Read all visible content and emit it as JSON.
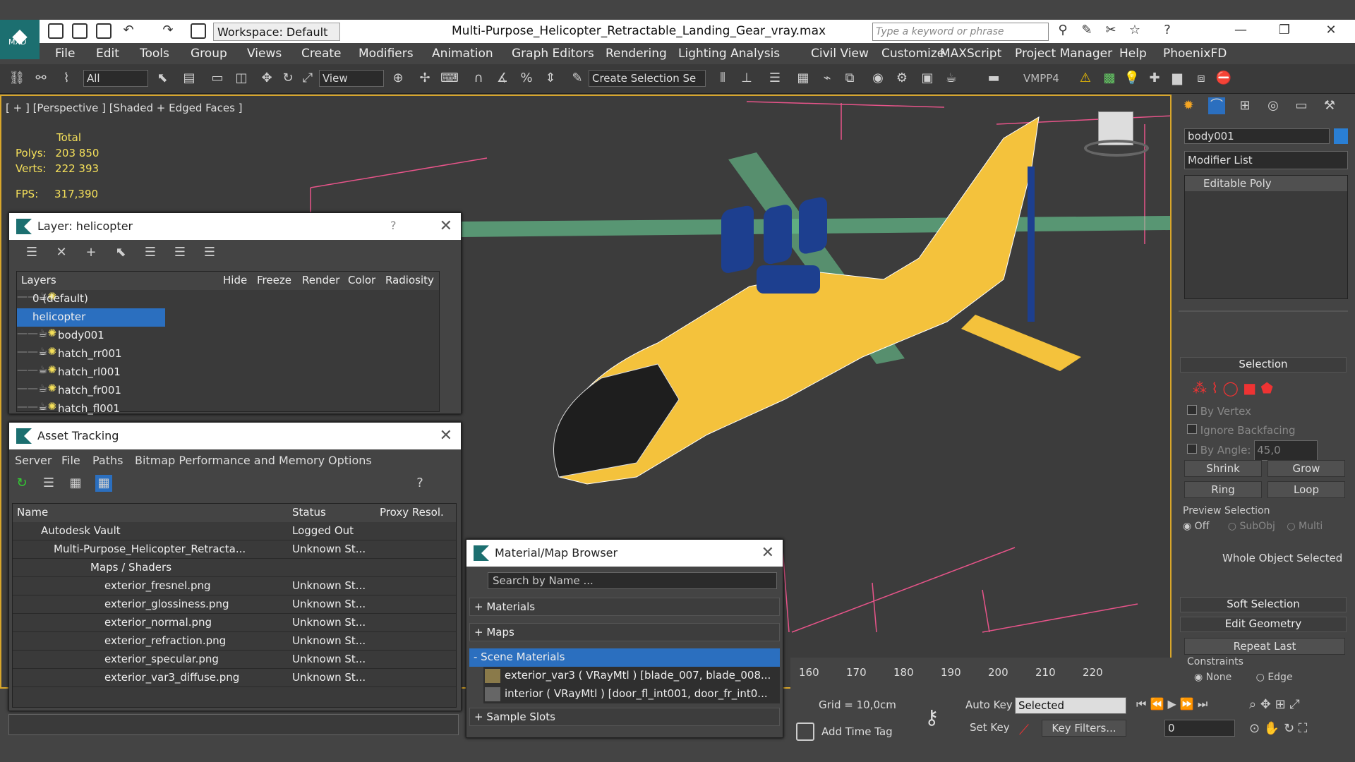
{
  "app": {
    "window_title": "Multi-Purpose_Helicopter_Retractable_Landing_Gear_vray.max",
    "logo_text": "MXD",
    "workspace": "Workspace: Default",
    "search_placeholder": "Type a keyword or phrase"
  },
  "menu": [
    "File",
    "Edit",
    "Tools",
    "Group",
    "Views",
    "Create",
    "Modifiers",
    "Animation",
    "Graph Editors",
    "Rendering",
    "Lighting Analysis",
    "Civil View",
    "Customize",
    "MAXScript",
    "Project Manager",
    "Help",
    "PhoenixFD"
  ],
  "toolbar": {
    "filter": "All",
    "ref_coord": "View",
    "selection_set": "Create Selection Se",
    "vmpp": "VMPP4"
  },
  "viewport": {
    "label": "[ + ] [Perspective ] [Shaded + Edged Faces ]",
    "stats_total": "Total",
    "polys_label": "Polys:",
    "polys_value": "203 850",
    "verts_label": "Verts:",
    "verts_value": "222 393",
    "fps_label": "FPS:",
    "fps_value": "317,390"
  },
  "layer_window": {
    "title": "Layer: helicopter",
    "help": "?",
    "columns": [
      "Layers",
      "Hide",
      "Freeze",
      "Render",
      "Color",
      "Radiosity"
    ],
    "rows": [
      {
        "name": "0 (default)",
        "color": "#b5e04a"
      },
      {
        "name": "helicopter",
        "color": "#a8e0e0"
      },
      {
        "name": "body001",
        "color": "#1e5fc0"
      },
      {
        "name": "hatch_rr001",
        "color": "#1e5fc0"
      },
      {
        "name": "hatch_rl001",
        "color": "#1e5fc0"
      },
      {
        "name": "hatch_fr001",
        "color": "#1e5fc0"
      },
      {
        "name": "hatch_fl001",
        "color": "#1e5fc0"
      }
    ]
  },
  "asset_window": {
    "title": "Asset Tracking",
    "menu": [
      "Server",
      "File",
      "Paths",
      "Bitmap Performance and Memory",
      "Options"
    ],
    "columns": [
      "Name",
      "Status",
      "Proxy Resol."
    ],
    "rows": [
      {
        "name": "Autodesk Vault",
        "status": "Logged Out"
      },
      {
        "name": "Multi-Purpose_Helicopter_Retracta...",
        "status": "Unknown St..."
      },
      {
        "name": "Maps / Shaders",
        "status": ""
      },
      {
        "name": "exterior_fresnel.png",
        "status": "Unknown St..."
      },
      {
        "name": "exterior_glossiness.png",
        "status": "Unknown St..."
      },
      {
        "name": "exterior_normal.png",
        "status": "Unknown St..."
      },
      {
        "name": "exterior_refraction.png",
        "status": "Unknown St..."
      },
      {
        "name": "exterior_specular.png",
        "status": "Unknown St..."
      },
      {
        "name": "exterior_var3_diffuse.png",
        "status": "Unknown St..."
      }
    ]
  },
  "material_browser": {
    "title": "Material/Map Browser",
    "search_placeholder": "Search by Name ...",
    "sections": [
      "+ Materials",
      "+ Maps",
      "- Scene Materials"
    ],
    "items": [
      "exterior_var3  ( VRayMtl ) [blade_007, blade_008...",
      "interior  ( VRayMtl ) [door_fl_int001, door_fr_int0..."
    ],
    "footer": "+ Sample Slots"
  },
  "command_panel": {
    "object_name": "body001",
    "object_color": "#2a7fd4",
    "modifier_list": "Modifier List",
    "stack_item": "Editable Poly",
    "selection_title": "Selection",
    "by_vertex": "By Vertex",
    "ignore_backfacing": "Ignore Backfacing",
    "by_angle": "By Angle:",
    "angle_value": "45,0",
    "shrink": "Shrink",
    "grow": "Grow",
    "ring": "Ring",
    "loop": "Loop",
    "preview_selection": "Preview Selection",
    "preview_off": "Off",
    "preview_subobj": "SubObj",
    "preview_multi": "Multi",
    "whole_object": "Whole Object Selected",
    "soft_selection": "Soft Selection",
    "edit_geometry": "Edit Geometry",
    "repeat_last": "Repeat Last",
    "constraints": "Constraints",
    "constraint_none": "None",
    "constraint_edge": "Edge"
  },
  "timeline": {
    "ticks": [
      "160",
      "170",
      "180",
      "190",
      "200",
      "210",
      "220"
    ]
  },
  "statusbar": {
    "grid": "Grid = 10,0cm",
    "add_time_tag": "Add Time Tag",
    "auto_key": "Auto Key",
    "set_key": "Set Key",
    "selected": "Selected",
    "key_filters": "Key Filters...",
    "frame": "0"
  }
}
